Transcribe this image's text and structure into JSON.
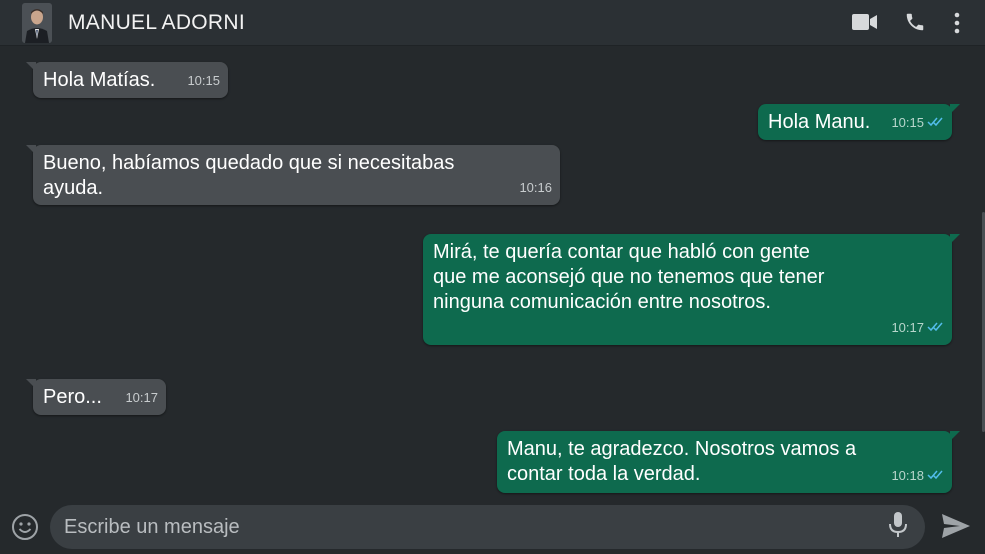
{
  "header": {
    "contact_name": "MANUEL ADORNI",
    "icons": [
      "avatar",
      "video-call-icon",
      "phone-call-icon",
      "more-options-icon"
    ]
  },
  "messages": [
    {
      "direction": "in",
      "text": "Hola Matías.",
      "time": "10:15"
    },
    {
      "direction": "out",
      "text": "Hola Manu.",
      "time": "10:15",
      "status": "read-double-check"
    },
    {
      "direction": "in",
      "text": "Bueno, habíamos quedado que si necesitabas\nayuda.",
      "time": "10:16"
    },
    {
      "direction": "out",
      "text": "Mirá, te quería contar que habló con gente\nque me aconsejó que no tenemos que tener\nninguna comunicación entre nosotros.",
      "time": "10:17",
      "status": "read-double-check"
    },
    {
      "direction": "in",
      "text": "Pero...",
      "time": "10:17"
    },
    {
      "direction": "out",
      "text": "Manu, te agradezco. Nosotros vamos a\ncontar toda la verdad.",
      "time": "10:18",
      "status": "read-double-check"
    }
  ],
  "input": {
    "placeholder": "Escribe un mensaje",
    "value": "",
    "icons": [
      "emoji-icon",
      "microphone-icon",
      "send-icon"
    ]
  },
  "colors": {
    "background": "#25292c",
    "header": "#2b3034",
    "incoming_bubble": "#4a4e52",
    "outgoing_bubble": "#0e6a4e",
    "read_ticks": "#53bdeb"
  }
}
